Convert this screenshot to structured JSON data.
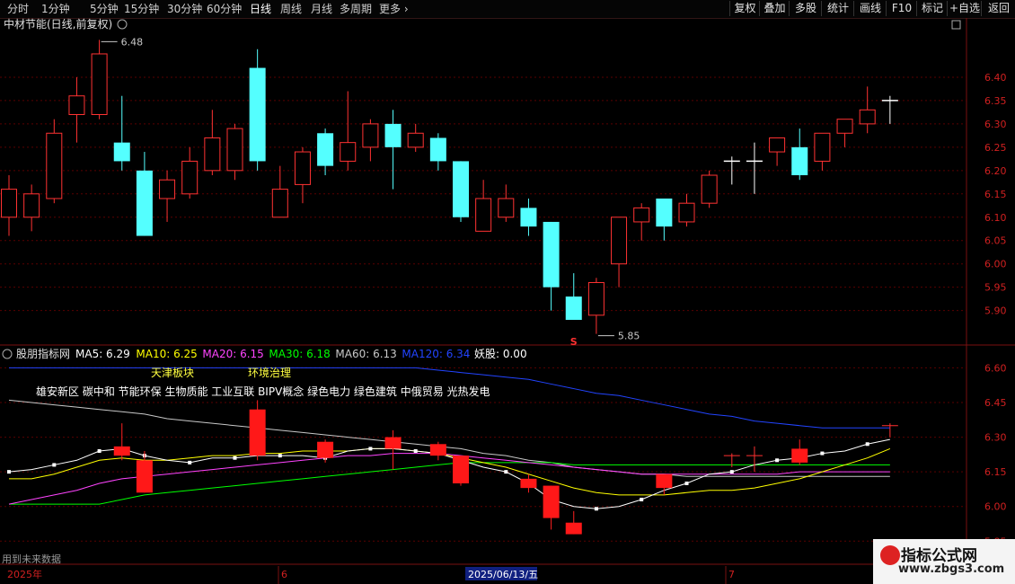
{
  "toolbar": {
    "periods": [
      "分时",
      "1分钟",
      "5分钟",
      "15分钟",
      "30分钟",
      "60分钟",
      "日线",
      "周线",
      "月线",
      "多周期",
      "更多"
    ],
    "active_period": "日线",
    "right_buttons": [
      "复权",
      "叠加",
      "多股",
      "统计",
      "画线",
      "F10",
      "标记",
      "+自选",
      "返回"
    ]
  },
  "main_panel": {
    "title": "中材节能(日线,前复权)",
    "high_label": "6.48",
    "low_label": "5.85",
    "s_marker": "S",
    "y_ticks": [
      5.9,
      5.95,
      6.0,
      6.05,
      6.1,
      6.15,
      6.2,
      6.25,
      6.3,
      6.35,
      6.4
    ]
  },
  "sub_panel": {
    "title": "股朋指标网",
    "ma_labels": [
      {
        "text": "MA5: 6.29",
        "color": "#ffffff"
      },
      {
        "text": "MA10: 6.25",
        "color": "#ffff00"
      },
      {
        "text": "MA20: 6.15",
        "color": "#ff44ff"
      },
      {
        "text": "MA30: 6.18",
        "color": "#00ff00"
      },
      {
        "text": "MA60: 6.13",
        "color": "#c8c8c8"
      },
      {
        "text": "MA120: 6.34",
        "color": "#2244ff"
      },
      {
        "text": "妖股: 0.00",
        "color": "#ffffff"
      }
    ],
    "tags_yellow": [
      "天津板块",
      "环境治理"
    ],
    "concepts": "雄安新区 碳中和 节能环保 生物质能 工业互联 BIPV概念 绿色电力 绿色建筑 中俄贸易 光热发电",
    "y_ticks": [
      5.85,
      6.0,
      6.15,
      6.3,
      6.45,
      6.6
    ],
    "footer_note": "用到未来数据"
  },
  "date_axis": {
    "labels": [
      "2025年",
      "6",
      "2025/06/13/五",
      "7"
    ]
  },
  "watermark": {
    "line1": "指标公式网",
    "line2": "www.zbgs3.com"
  },
  "chart_data": {
    "type": "candlestick",
    "candles": [
      {
        "o": 6.1,
        "h": 6.19,
        "l": 6.06,
        "c": 6.16
      },
      {
        "o": 6.1,
        "h": 6.17,
        "l": 6.07,
        "c": 6.15
      },
      {
        "o": 6.14,
        "h": 6.31,
        "l": 6.13,
        "c": 6.28
      },
      {
        "o": 6.32,
        "h": 6.4,
        "l": 6.26,
        "c": 6.36
      },
      {
        "o": 6.32,
        "h": 6.48,
        "l": 6.31,
        "c": 6.45
      },
      {
        "o": 6.26,
        "h": 6.36,
        "l": 6.2,
        "c": 6.22
      },
      {
        "o": 6.2,
        "h": 6.24,
        "l": 6.06,
        "c": 6.06
      },
      {
        "o": 6.14,
        "h": 6.2,
        "l": 6.09,
        "c": 6.18
      },
      {
        "o": 6.15,
        "h": 6.25,
        "l": 6.14,
        "c": 6.22
      },
      {
        "o": 6.2,
        "h": 6.33,
        "l": 6.19,
        "c": 6.27
      },
      {
        "o": 6.2,
        "h": 6.3,
        "l": 6.18,
        "c": 6.29
      },
      {
        "o": 6.42,
        "h": 6.46,
        "l": 6.2,
        "c": 6.22
      },
      {
        "o": 6.1,
        "h": 6.21,
        "l": 6.1,
        "c": 6.16
      },
      {
        "o": 6.17,
        "h": 6.25,
        "l": 6.13,
        "c": 6.24
      },
      {
        "o": 6.28,
        "h": 6.29,
        "l": 6.19,
        "c": 6.21
      },
      {
        "o": 6.22,
        "h": 6.37,
        "l": 6.2,
        "c": 6.26
      },
      {
        "o": 6.25,
        "h": 6.31,
        "l": 6.22,
        "c": 6.3
      },
      {
        "o": 6.3,
        "h": 6.33,
        "l": 6.16,
        "c": 6.25
      },
      {
        "o": 6.25,
        "h": 6.3,
        "l": 6.24,
        "c": 6.28
      },
      {
        "o": 6.27,
        "h": 6.28,
        "l": 6.2,
        "c": 6.22
      },
      {
        "o": 6.22,
        "h": 6.22,
        "l": 6.09,
        "c": 6.1
      },
      {
        "o": 6.07,
        "h": 6.18,
        "l": 6.07,
        "c": 6.14
      },
      {
        "o": 6.1,
        "h": 6.17,
        "l": 6.09,
        "c": 6.14
      },
      {
        "o": 6.12,
        "h": 6.14,
        "l": 6.06,
        "c": 6.08
      },
      {
        "o": 6.09,
        "h": 6.09,
        "l": 5.9,
        "c": 5.95
      },
      {
        "o": 5.93,
        "h": 5.98,
        "l": 5.88,
        "c": 5.88
      },
      {
        "o": 5.89,
        "h": 5.97,
        "l": 5.85,
        "c": 5.96
      },
      {
        "o": 6.0,
        "h": 6.1,
        "l": 5.95,
        "c": 6.1
      },
      {
        "o": 6.09,
        "h": 6.13,
        "l": 6.05,
        "c": 6.12
      },
      {
        "o": 6.14,
        "h": 6.14,
        "l": 6.05,
        "c": 6.08
      },
      {
        "o": 6.09,
        "h": 6.15,
        "l": 6.08,
        "c": 6.13
      },
      {
        "o": 6.13,
        "h": 6.2,
        "l": 6.12,
        "c": 6.19
      },
      {
        "o": 6.21,
        "h": 6.23,
        "l": 6.17,
        "c": 6.22
      },
      {
        "o": 6.22,
        "h": 6.26,
        "l": 6.15,
        "c": 6.22
      },
      {
        "o": 6.24,
        "h": 6.27,
        "l": 6.21,
        "c": 6.27
      },
      {
        "o": 6.25,
        "h": 6.29,
        "l": 6.18,
        "c": 6.19
      },
      {
        "o": 6.22,
        "h": 6.28,
        "l": 6.2,
        "c": 6.28
      },
      {
        "o": 6.28,
        "h": 6.31,
        "l": 6.25,
        "c": 6.31
      },
      {
        "o": 6.3,
        "h": 6.38,
        "l": 6.28,
        "c": 6.33
      },
      {
        "o": 6.35,
        "h": 6.36,
        "l": 6.3,
        "c": 6.35
      }
    ],
    "sub_ylim": [
      5.82,
      6.66
    ],
    "main_ylim": [
      5.83,
      6.5
    ],
    "ma_series": [
      {
        "key": "ma120",
        "color": "#2244ff",
        "values": [
          6.6,
          6.6,
          6.6,
          6.6,
          6.6,
          6.6,
          6.6,
          6.6,
          6.6,
          6.6,
          6.6,
          6.6,
          6.6,
          6.6,
          6.6,
          6.6,
          6.6,
          6.6,
          6.6,
          6.59,
          6.58,
          6.57,
          6.56,
          6.55,
          6.53,
          6.51,
          6.49,
          6.48,
          6.46,
          6.44,
          6.42,
          6.4,
          6.39,
          6.37,
          6.36,
          6.35,
          6.34,
          6.34,
          6.34,
          6.34
        ]
      },
      {
        "key": "ma60",
        "color": "#c8c8c8",
        "values": [
          6.46,
          6.45,
          6.44,
          6.43,
          6.42,
          6.41,
          6.4,
          6.38,
          6.37,
          6.36,
          6.35,
          6.34,
          6.33,
          6.32,
          6.31,
          6.3,
          6.29,
          6.28,
          6.27,
          6.26,
          6.25,
          6.23,
          6.22,
          6.2,
          6.19,
          6.17,
          6.16,
          6.15,
          6.14,
          6.14,
          6.13,
          6.13,
          6.13,
          6.13,
          6.13,
          6.13,
          6.13,
          6.13,
          6.13,
          6.13
        ]
      },
      {
        "key": "ma30",
        "color": "#00ff00",
        "values": [
          6.01,
          6.01,
          6.01,
          6.01,
          6.01,
          6.03,
          6.05,
          6.06,
          6.07,
          6.08,
          6.09,
          6.1,
          6.11,
          6.12,
          6.13,
          6.14,
          6.15,
          6.16,
          6.17,
          6.18,
          6.19,
          6.19,
          6.19,
          6.19,
          6.19,
          6.18,
          6.18,
          6.18,
          6.18,
          6.18,
          6.18,
          6.18,
          6.18,
          6.18,
          6.18,
          6.18,
          6.18,
          6.18,
          6.18,
          6.18
        ]
      },
      {
        "key": "ma20",
        "color": "#ff44ff",
        "values": [
          6.01,
          6.03,
          6.05,
          6.07,
          6.1,
          6.12,
          6.13,
          6.14,
          6.15,
          6.16,
          6.17,
          6.18,
          6.19,
          6.2,
          6.21,
          6.22,
          6.22,
          6.23,
          6.23,
          6.23,
          6.22,
          6.21,
          6.2,
          6.19,
          6.18,
          6.17,
          6.16,
          6.15,
          6.14,
          6.14,
          6.14,
          6.14,
          6.14,
          6.14,
          6.14,
          6.15,
          6.15,
          6.15,
          6.15,
          6.15
        ]
      },
      {
        "key": "ma10",
        "color": "#ffff00",
        "values": [
          6.12,
          6.12,
          6.14,
          6.17,
          6.2,
          6.21,
          6.2,
          6.2,
          6.21,
          6.22,
          6.22,
          6.23,
          6.23,
          6.24,
          6.24,
          6.24,
          6.25,
          6.25,
          6.24,
          6.23,
          6.21,
          6.19,
          6.17,
          6.14,
          6.11,
          6.08,
          6.06,
          6.05,
          6.05,
          6.05,
          6.06,
          6.07,
          6.07,
          6.08,
          6.1,
          6.12,
          6.15,
          6.18,
          6.21,
          6.25
        ]
      },
      {
        "key": "ma5",
        "color": "#ffffff",
        "values": [
          6.15,
          6.16,
          6.18,
          6.2,
          6.24,
          6.25,
          6.22,
          6.2,
          6.19,
          6.21,
          6.21,
          6.22,
          6.22,
          6.22,
          6.21,
          6.24,
          6.25,
          6.25,
          6.24,
          6.23,
          6.2,
          6.17,
          6.15,
          6.1,
          6.03,
          6.0,
          5.99,
          6.0,
          6.03,
          6.07,
          6.1,
          6.14,
          6.15,
          6.18,
          6.2,
          6.21,
          6.23,
          6.24,
          6.27,
          6.29
        ]
      }
    ]
  }
}
